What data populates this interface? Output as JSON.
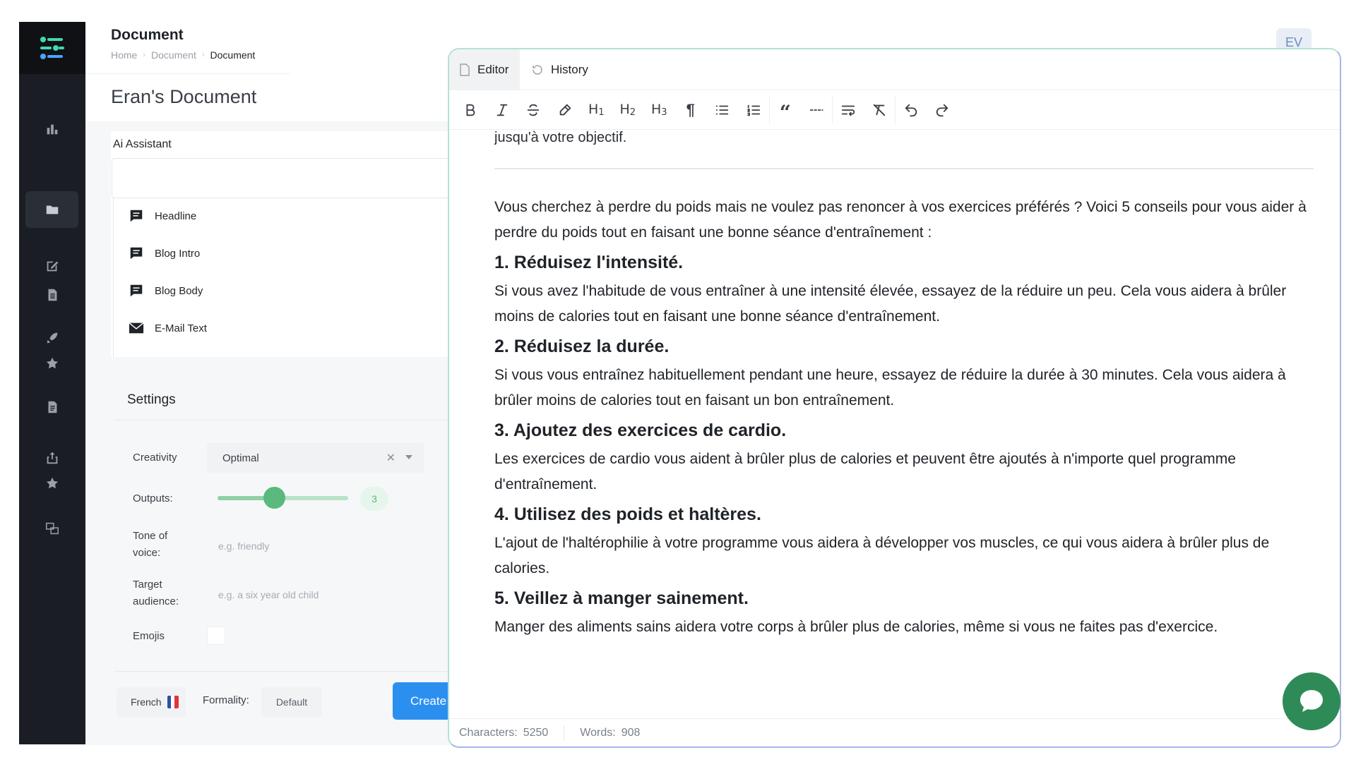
{
  "header": {
    "title": "Document",
    "breadcrumb": [
      "Home",
      "Document",
      "Document"
    ]
  },
  "document_title": "Eran's Document",
  "avatar_initials": "EV",
  "ai_assistant": {
    "label": "Ai Assistant",
    "items": [
      {
        "label": "Headline",
        "icon": "chat-bubble-icon"
      },
      {
        "label": "Blog Intro",
        "icon": "chat-bubble-icon"
      },
      {
        "label": "Blog Body",
        "icon": "chat-bubble-icon"
      },
      {
        "label": "E-Mail Text",
        "icon": "envelope-icon"
      }
    ]
  },
  "settings": {
    "title": "Settings",
    "creativity_label": "Creativity",
    "creativity_value": "Optimal",
    "outputs_label": "Outputs:",
    "outputs_value": "3",
    "outputs_fraction": 0.43,
    "tone_label_1": "Tone of",
    "tone_label_2": "voice:",
    "tone_placeholder": "e.g. friendly",
    "audience_label_1": "Target",
    "audience_label_2": "audience:",
    "audience_placeholder": "e.g. a six year old child",
    "emojis_label": "Emojis"
  },
  "footer": {
    "language": "French",
    "formality_label": "Formality:",
    "formality_value": "Default",
    "create_label": "Create"
  },
  "editor": {
    "tabs": [
      "Editor",
      "History"
    ],
    "cut_text": "jusqu'à votre objectif.",
    "intro": "Vous cherchez à perdre du poids mais ne voulez pas renoncer à vos exercices préférés ? Voici 5 conseils pour vous aider à perdre du poids tout en faisant une bonne séance d'entraînement :",
    "sections": [
      {
        "heading": "1. Réduisez l'intensité.",
        "text": "Si vous avez l'habitude de vous entraîner à une intensité élevée, essayez de la réduire un peu. Cela vous aidera à brûler moins de calories tout en faisant une bonne séance d'entraînement."
      },
      {
        "heading": "2. Réduisez la durée.",
        "text": "Si vous vous entraînez habituellement pendant une heure, essayez de réduire la durée à 30 minutes. Cela vous aidera à brûler moins de calories tout en faisant un bon entraînement."
      },
      {
        "heading": "3. Ajoutez des exercices de cardio.",
        "text": "Les exercices de cardio vous aident à brûler plus de calories et peuvent être ajoutés à n'importe quel programme d'entraînement."
      },
      {
        "heading": "4. Utilisez des poids et haltères.",
        "text": "L'ajout de l'haltérophilie à votre programme vous aidera à développer vos muscles, ce qui vous aidera à brûler plus de calories."
      },
      {
        "heading": "5. Veillez à manger sainement.",
        "text": "Manger des aliments sains aidera votre corps à brûler plus de calories, même si vous ne faites pas d'exercice."
      }
    ],
    "status": {
      "characters_label": "Characters:",
      "characters_value": "5250",
      "words_label": "Words:",
      "words_value": "908"
    }
  },
  "colors": {
    "sidebar": "#1a1d24",
    "accent_green": "#5ab97c",
    "create_blue": "#2b8ff0",
    "chat_green": "#2e8b57"
  }
}
